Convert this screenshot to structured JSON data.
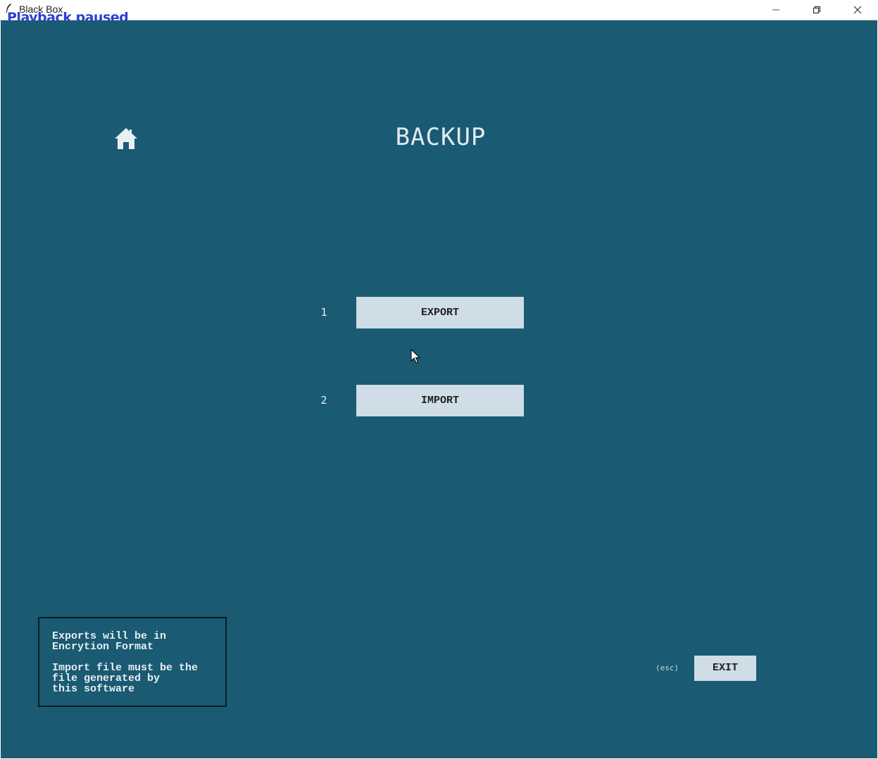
{
  "window": {
    "title": "Black Box",
    "status_overlay": "Playback paused",
    "controls": {
      "minimize_icon": "minimize-icon",
      "maximize_icon": "restore-icon",
      "close_icon": "close-icon"
    }
  },
  "colors": {
    "background": "#1a5a72",
    "button_bg": "#cfdde6",
    "text_light": "#dfeaf1",
    "overlay_text": "#2b3fd6"
  },
  "header": {
    "home_icon": "home-icon",
    "title": "BACKUP"
  },
  "options": [
    {
      "number": "1",
      "label": "EXPORT"
    },
    {
      "number": "2",
      "label": "IMPORT"
    }
  ],
  "info": {
    "line1": "Exports will be in",
    "line2": "Encrytion Format",
    "line3": "Import file must be the",
    "line4": "file generated by",
    "line5": "this software"
  },
  "footer": {
    "esc_hint": "(esc)",
    "exit_label": "EXIT"
  }
}
